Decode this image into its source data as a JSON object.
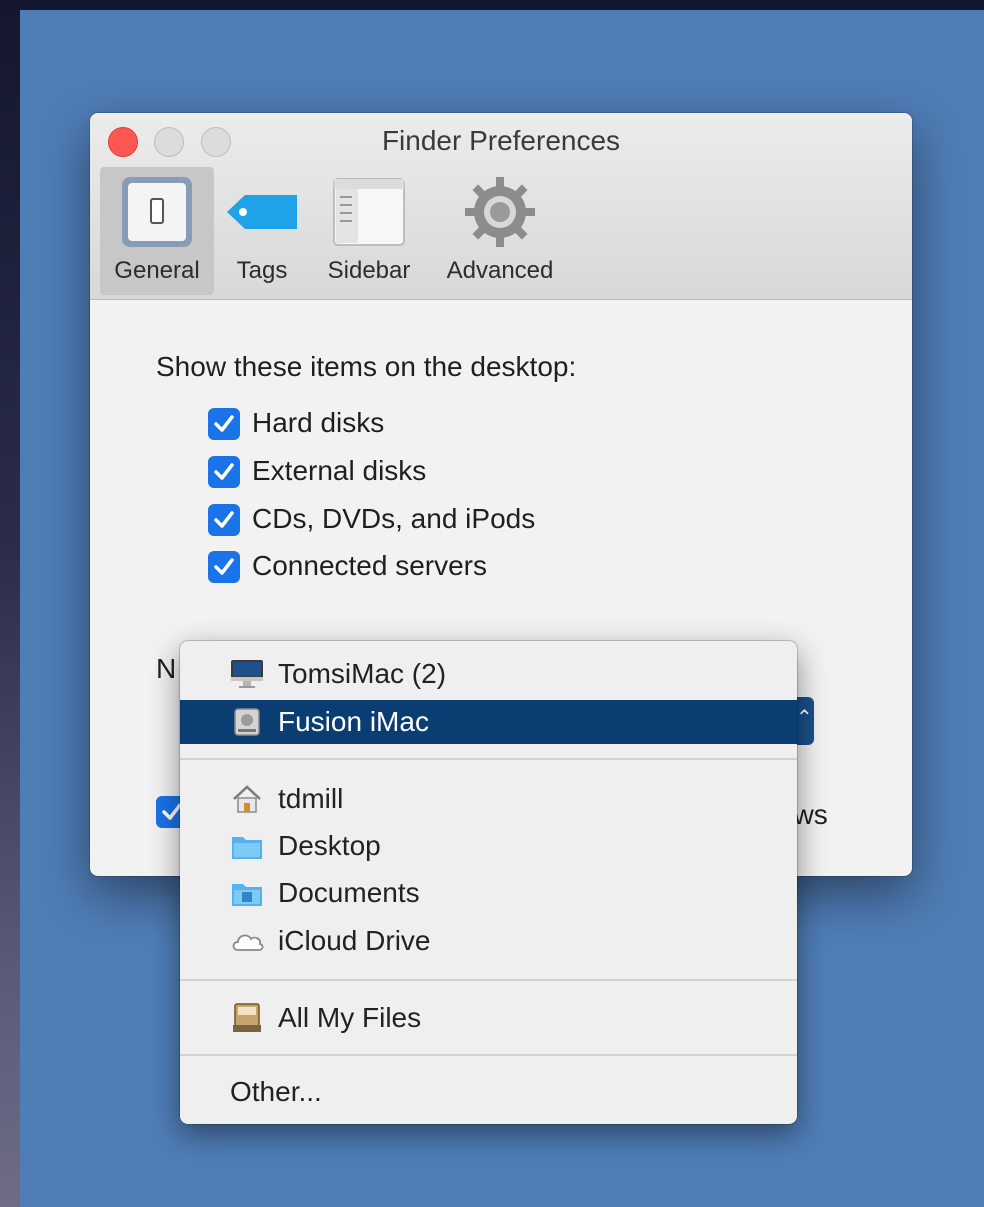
{
  "window": {
    "title": "Finder Preferences"
  },
  "tabs": [
    {
      "label": "General",
      "icon": "switch-icon",
      "selected": true
    },
    {
      "label": "Tags",
      "icon": "tag-icon"
    },
    {
      "label": "Sidebar",
      "icon": "sidebar-icon"
    },
    {
      "label": "Advanced",
      "icon": "gear-icon"
    }
  ],
  "general": {
    "desktop_heading": "Show these items on the desktop:",
    "desktop_items": [
      {
        "label": "Hard disks",
        "checked": true
      },
      {
        "label": "External disks",
        "checked": true
      },
      {
        "label": "CDs, DVDs, and iPods",
        "checked": true
      },
      {
        "label": "Connected servers",
        "checked": true
      }
    ],
    "hidden_label_fragment": "N",
    "hidden_checkbox_fragment": "ows"
  },
  "menu": {
    "items": [
      {
        "label": "TomsiMac (2)",
        "icon": "imac-icon",
        "selected": false
      },
      {
        "label": "Fusion iMac",
        "icon": "hard-drive-icon",
        "selected": true
      },
      {
        "label": "tdmill",
        "icon": "home-icon",
        "selected": false
      },
      {
        "label": "Desktop",
        "icon": "folder-icon",
        "selected": false
      },
      {
        "label": "Documents",
        "icon": "documents-folder-icon",
        "selected": false
      },
      {
        "label": "iCloud Drive",
        "icon": "cloud-icon",
        "selected": false
      },
      {
        "label": "All My Files",
        "icon": "all-files-icon",
        "selected": false
      },
      {
        "label": "Other...",
        "icon": "",
        "selected": false
      }
    ]
  },
  "colors": {
    "desktop": "#4f7db6",
    "selection": "#0a3d72",
    "checkbox": "#1a73e8",
    "close_button": "#fc5753"
  }
}
